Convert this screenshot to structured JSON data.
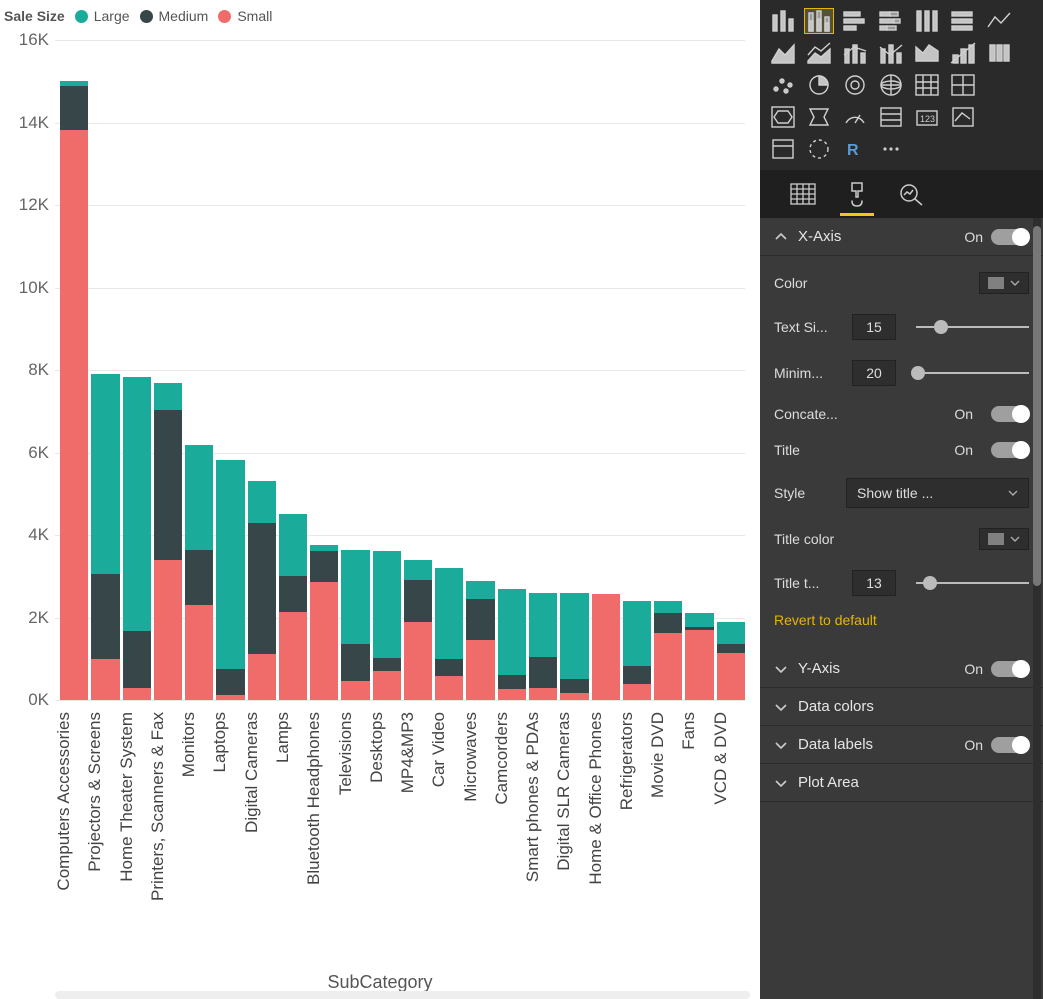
{
  "legend": {
    "title": "Sale Size",
    "items": [
      {
        "label": "Large",
        "color": "#1aab9b"
      },
      {
        "label": "Medium",
        "color": "#374649"
      },
      {
        "label": "Small",
        "color": "#f06c6b"
      }
    ]
  },
  "chart_data": {
    "type": "bar",
    "stacked": true,
    "xlabel": "SubCategory",
    "ylabel": "",
    "ylim": [
      0,
      16000
    ],
    "yticks": [
      "0K",
      "2K",
      "4K",
      "6K",
      "8K",
      "10K",
      "12K",
      "14K",
      "16K"
    ],
    "categories": [
      "Computers Accessories",
      "Projectors & Screens",
      "Home Theater System",
      "Printers, Scanners & Fax",
      "Monitors",
      "Laptops",
      "Digital Cameras",
      "Lamps",
      "Bluetooth Headphones",
      "Televisions",
      "Desktops",
      "MP4&MP3",
      "Car Video",
      "Microwaves",
      "Camcorders",
      "Smart phones & PDAs",
      "Digital SLR Cameras",
      "Home & Office Phones",
      "Refrigerators",
      "Movie DVD",
      "Fans",
      "VCD & DVD"
    ],
    "series": [
      {
        "name": "Large",
        "color": "#1aab9b",
        "values": [
          120,
          4850,
          6150,
          650,
          2550,
          5050,
          1000,
          1500,
          130,
          2280,
          2600,
          500,
          2200,
          420,
          2080,
          1550,
          2100,
          0,
          1580,
          300,
          350,
          530
        ]
      },
      {
        "name": "Medium",
        "color": "#374649",
        "values": [
          1060,
          2050,
          1370,
          3640,
          1330,
          640,
          3180,
          870,
          770,
          900,
          320,
          1000,
          420,
          1000,
          330,
          750,
          320,
          0,
          420,
          480,
          70,
          230
        ]
      },
      {
        "name": "Small",
        "color": "#f06c6b",
        "values": [
          13830,
          1000,
          300,
          3390,
          2300,
          120,
          1120,
          2130,
          2850,
          460,
          700,
          1900,
          580,
          1460,
          270,
          300,
          180,
          2560,
          400,
          1620,
          1690,
          1140
        ]
      }
    ]
  },
  "format": {
    "sections": {
      "xaxis": {
        "label": "X-Axis",
        "on": "On",
        "color": "#808080",
        "props": {
          "color_label": "Color",
          "textsize": {
            "label": "Text Si...",
            "value": "15",
            "pct": 22
          },
          "minimum": {
            "label": "Minim...",
            "value": "20",
            "pct": 2
          },
          "concatenate": {
            "label": "Concate...",
            "on": "On"
          },
          "title": {
            "label": "Title",
            "on": "On"
          },
          "style": {
            "label": "Style",
            "value": "Show title ..."
          },
          "titlecolor": {
            "label": "Title color",
            "color": "#808080"
          },
          "titletext": {
            "label": "Title t...",
            "value": "13",
            "pct": 12
          }
        },
        "revert": "Revert to default"
      },
      "yaxis": {
        "label": "Y-Axis",
        "on": "On"
      },
      "datacolors": {
        "label": "Data colors"
      },
      "datalabels": {
        "label": "Data labels",
        "on": "On"
      },
      "plotarea": {
        "label": "Plot Area"
      }
    }
  }
}
